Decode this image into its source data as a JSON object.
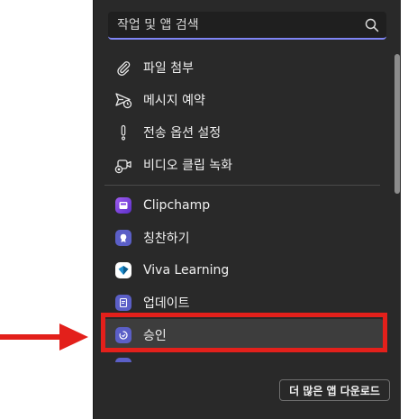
{
  "search": {
    "placeholder": "작업 및 앱 검색"
  },
  "actions": [
    {
      "label": "파일 첨부",
      "icon": "paperclip-icon"
    },
    {
      "label": "메시지 예약",
      "icon": "send-clock-icon"
    },
    {
      "label": "전송 옵션 설정",
      "icon": "exclamation-icon"
    },
    {
      "label": "비디오 클립 녹화",
      "icon": "video-clip-icon"
    }
  ],
  "apps": [
    {
      "label": "Clipchamp",
      "icon": "clipchamp-icon",
      "color": "#7b3fe4"
    },
    {
      "label": "칭찬하기",
      "icon": "praise-icon",
      "color": "#5b5fc7"
    },
    {
      "label": "Viva Learning",
      "icon": "viva-learning-icon",
      "color": "#1f8fcf"
    },
    {
      "label": "업데이트",
      "icon": "updates-icon",
      "color": "#5b5fc7"
    },
    {
      "label": "승인",
      "icon": "approvals-icon",
      "color": "#5b5fc7"
    }
  ],
  "footer": {
    "download_label": "더 많은 앱 다운로드"
  },
  "colors": {
    "panel_bg": "#292929",
    "accent": "#7f85f5",
    "highlight": "#e3201b"
  }
}
